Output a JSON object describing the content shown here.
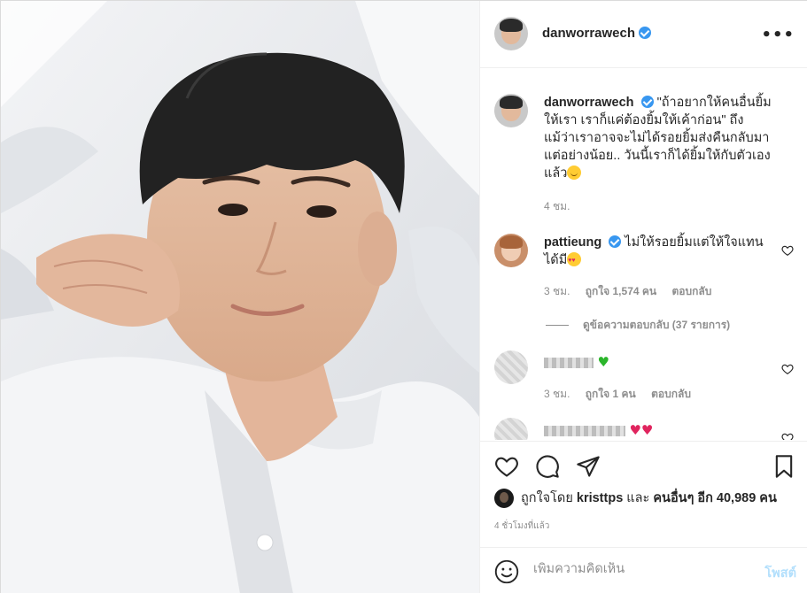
{
  "post": {
    "author": "danworrawech",
    "verified": true,
    "more_icon": "more-horizontal-icon"
  },
  "caption": {
    "username": "danworrawech",
    "text": "\"ถ้าอยากให้คนอื่นยิ้มให้เรา เราก็แค่ต้องยิ้มให้เค้าก่อน\" ถึงแม้ว่าเราอาจจะไม่ได้รอยยิ้มส่งคืนกลับมา แต่อย่างน้อย.. วันนี้เราก็ได้ยิ้มให้กับตัวเองแล้ว",
    "time": "4 ชม."
  },
  "comments": [
    {
      "username": "pattieung",
      "text": "ไม่ให้รอยยิ้มแต่ให้ใจแทนได้มี",
      "time": "3 ชม.",
      "likes": "ถูกใจ 1,574 คน",
      "reply": "ตอบกลับ",
      "view_replies": "ดูข้อความตอบกลับ (37 รายการ)"
    },
    {
      "time": "3 ชม.",
      "likes": "ถูกใจ 1 คน",
      "reply": "ตอบกลับ"
    }
  ],
  "likes_line": {
    "prefix": "ถูกใจโดย",
    "user": "kristtps",
    "middle": "และ",
    "others": "คนอื่นๆ อีก 40,989 คน"
  },
  "time_ago": "4 ชั่วโมงที่แล้ว",
  "add_comment": {
    "placeholder": "เพิ่มความคิดเห็น",
    "post_label": "โพสต์"
  },
  "colors": {
    "accent": "#3897f0",
    "muted": "#8e8e8e",
    "post_disabled": "#b2dffc"
  }
}
